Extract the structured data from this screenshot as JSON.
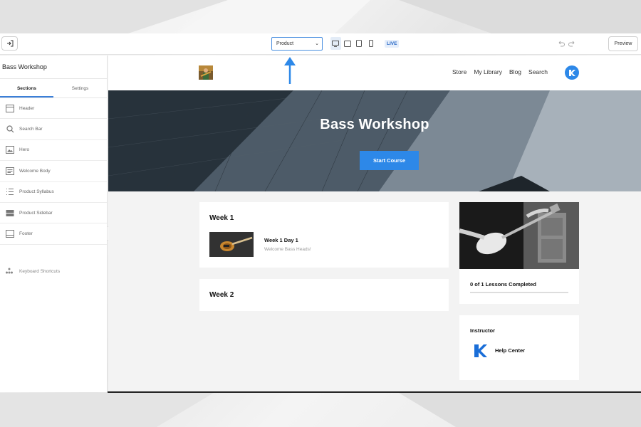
{
  "toolbar": {
    "page_select_value": "Product",
    "live_label": "LIVE",
    "preview_label": "Preview",
    "icons": [
      "exit-icon",
      "desktop-icon",
      "tablet-landscape-icon",
      "tablet-icon",
      "mobile-icon",
      "undo-icon",
      "redo-icon"
    ]
  },
  "sidebar": {
    "title": "Bass Workshop",
    "tabs": [
      {
        "label": "Sections",
        "active": true
      },
      {
        "label": "Settings",
        "active": false
      }
    ],
    "items": [
      {
        "label": "Header",
        "icon": "header-icon"
      },
      {
        "label": "Search Bar",
        "icon": "search-icon"
      },
      {
        "label": "Hero",
        "icon": "image-icon"
      },
      {
        "label": "Welcome Body",
        "icon": "text-block-icon"
      },
      {
        "label": "Product Syllabus",
        "icon": "list-icon"
      },
      {
        "label": "Product Sidebar",
        "icon": "sidebar-icon"
      },
      {
        "label": "Footer",
        "icon": "footer-icon"
      }
    ],
    "shortcuts_label": "Keyboard Shortcuts"
  },
  "site": {
    "nav": [
      "Store",
      "My Library",
      "Blog",
      "Search"
    ],
    "hero_title": "Bass Workshop",
    "hero_button": "Start Course",
    "weeks": [
      {
        "title": "Week 1",
        "lesson_title": "Week 1 Day 1",
        "lesson_sub": "Welcome Bass Heads!"
      },
      {
        "title": "Week 2"
      }
    ],
    "progress_text": "0 of 1 Lessons Completed",
    "progress_fraction": 0,
    "instructor_label": "Instructor",
    "instructor_name": "Help Center"
  },
  "colors": {
    "accent": "#2d88e8",
    "select_border": "#4a8fe0"
  }
}
